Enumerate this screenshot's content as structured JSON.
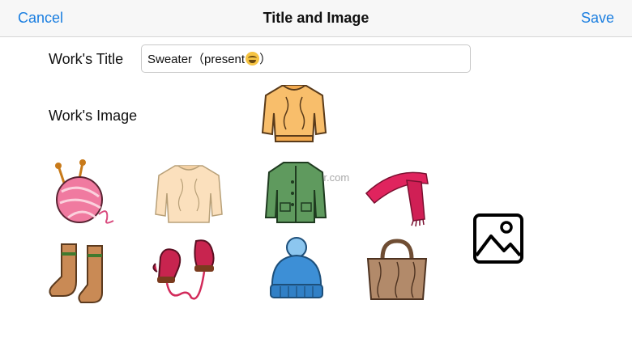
{
  "nav": {
    "cancel_label": "Cancel",
    "title": "Title and Image",
    "save_label": "Save",
    "accent_color": "#1a7ee0"
  },
  "form": {
    "title_label": "Work's Title",
    "title_value": "Sweater（present",
    "title_suffix": "）",
    "image_label": "Work's Image"
  },
  "watermark": "UpdateStar.com",
  "icons": {
    "selected": "sweater-icon",
    "grid": [
      "yarn-ball-icon",
      "sweater-icon",
      "cardigan-icon",
      "scarf-icon",
      "socks-icon",
      "mittens-icon",
      "knit-hat-icon",
      "knit-bag-icon"
    ],
    "photo": "image-picker-icon"
  }
}
